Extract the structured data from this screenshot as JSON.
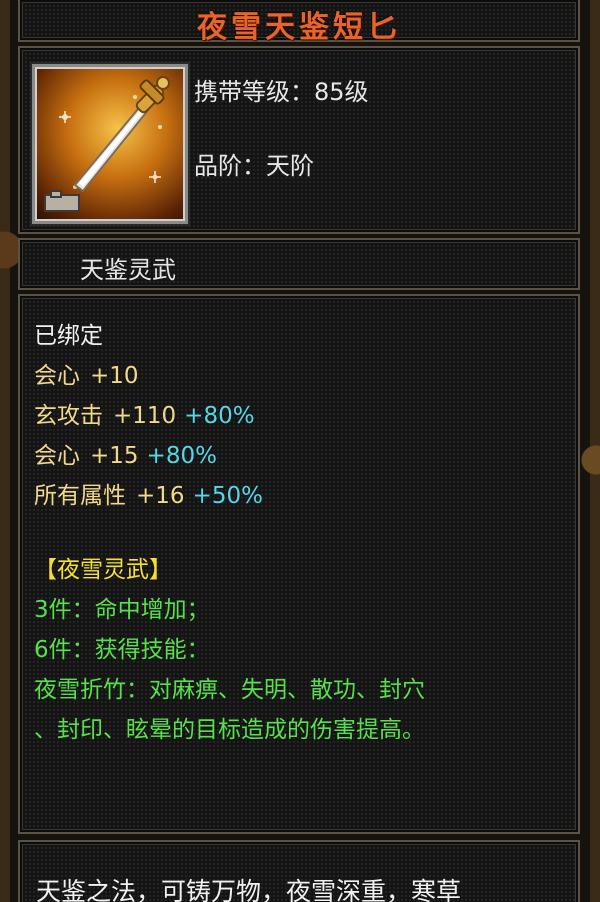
{
  "title": "夜雪天鉴短匕",
  "header": {
    "level_text": "携带等级：85级",
    "grade_text": "品阶：天阶"
  },
  "category": "天鉴灵武",
  "attributes": {
    "bound": "已绑定",
    "lines": [
      {
        "name": "会心",
        "value": "+10",
        "bonus": ""
      },
      {
        "name": "玄攻击",
        "value": "+110",
        "bonus": "+80%"
      },
      {
        "name": "会心",
        "value": "+15",
        "bonus": "+80%"
      },
      {
        "name": "所有属性",
        "value": "+16",
        "bonus": "+50%"
      }
    ]
  },
  "set": {
    "title": "【夜雪灵武】",
    "piece3": "3件：命中增加；",
    "piece6": "6件：获得技能：",
    "skill_line1": "夜雪折竹：对麻痹、失明、散功、封穴",
    "skill_line2": "、封印、眩晕的目标造成的伤害提高。"
  },
  "description": "天鉴之法，可铸万物，夜雪深重，寒草",
  "colors": {
    "title": "#e8642a",
    "stat_yellow": "#f0d98a",
    "bonus_cyan": "#55d6e8",
    "set_title": "#f5e032",
    "set_green": "#56e04c"
  },
  "icon": "dagger-icon"
}
